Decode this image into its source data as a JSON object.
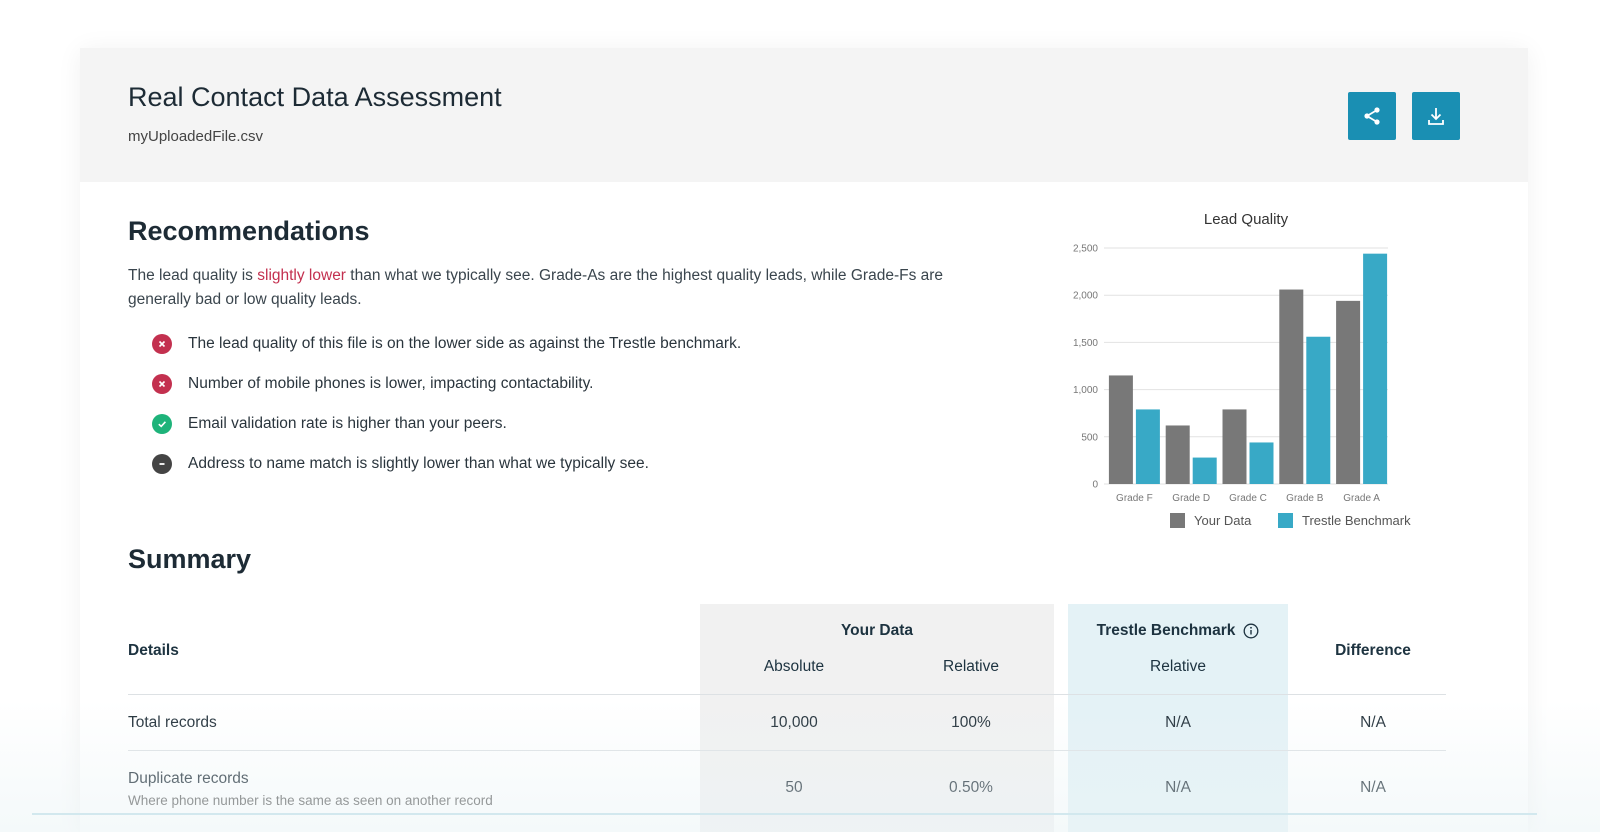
{
  "header": {
    "title": "Real Contact Data Assessment",
    "filename": "myUploadedFile.csv",
    "share_icon": "share-icon",
    "download_icon": "download-icon",
    "accent_color": "#1a8fb3"
  },
  "recommendations": {
    "title": "Recommendations",
    "intro_prefix": "The lead quality is ",
    "intro_highlight": "slightly lower",
    "intro_suffix": " than what we typically see. Grade-As are the highest quality leads, while Grade-Fs are generally bad or low quality leads.",
    "items": [
      {
        "status": "bad",
        "icon": "x-icon",
        "text": "The lead quality of this file is on the lower side as against the Trestle benchmark."
      },
      {
        "status": "bad",
        "icon": "x-icon",
        "text": "Number of mobile phones is lower, impacting contactability."
      },
      {
        "status": "good",
        "icon": "check-icon",
        "text": "Email validation rate is higher than your peers."
      },
      {
        "status": "neutral",
        "icon": "minus-icon",
        "text": "Address to name match is slightly lower than what we typically see."
      }
    ]
  },
  "chart_data": {
    "type": "bar",
    "title": "Lead Quality",
    "categories": [
      "Grade F",
      "Grade D",
      "Grade C",
      "Grade B",
      "Grade A"
    ],
    "series": [
      {
        "name": "Your Data",
        "color": "#787878",
        "values": [
          1150,
          620,
          790,
          2060,
          1940
        ]
      },
      {
        "name": "Trestle Benchmark",
        "color": "#38a9c6",
        "values": [
          790,
          280,
          440,
          1560,
          2440
        ]
      }
    ],
    "y_ticks": [
      "0",
      "500",
      "1,000",
      "1,500",
      "2,000",
      "2,500"
    ],
    "ylim": [
      0,
      2500
    ],
    "grid": true,
    "legend_placement": "bottom-center"
  },
  "summary": {
    "title": "Summary",
    "headers": {
      "details": "Details",
      "your_data": "Your Data",
      "absolute": "Absolute",
      "relative": "Relative",
      "benchmark": "Trestle Benchmark",
      "benchmark_relative": "Relative",
      "difference": "Difference",
      "info_icon": "info-icon"
    },
    "rows": [
      {
        "label": "Total records",
        "sublabel": "",
        "absolute": "10,000",
        "relative": "100%",
        "benchmark": "N/A",
        "difference": "N/A"
      },
      {
        "label": "Duplicate records",
        "sublabel": "Where phone number is the same as seen on another record",
        "absolute": "50",
        "relative": "0.50%",
        "benchmark": "N/A",
        "difference": "N/A"
      }
    ]
  }
}
